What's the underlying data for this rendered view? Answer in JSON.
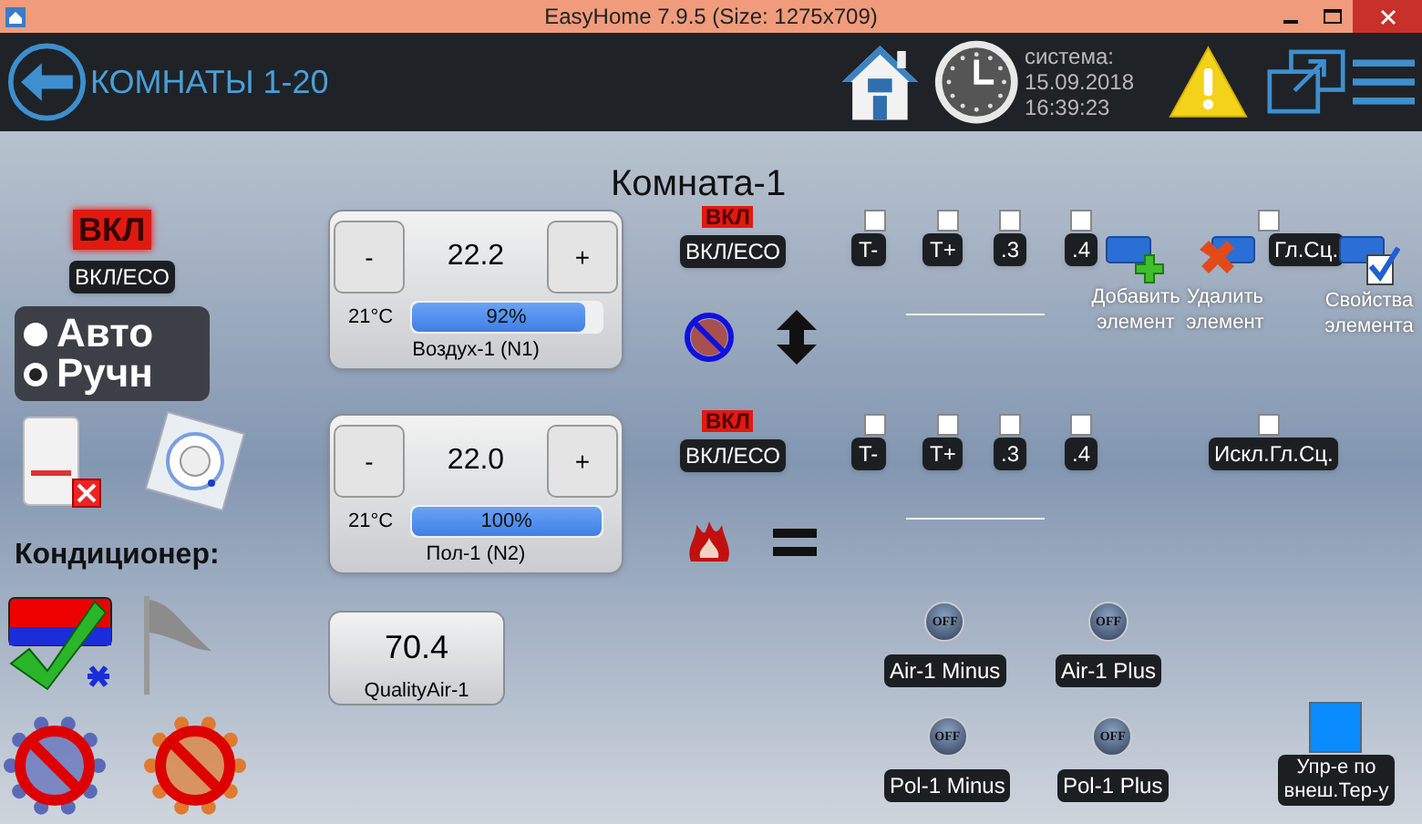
{
  "window": {
    "title": "EasyHome 7.9.5 (Size: 1275x709)"
  },
  "header": {
    "title": "КОМНАТЫ 1-20",
    "system_label": "система:",
    "date": "15.09.2018",
    "time": "16:39:23"
  },
  "room": {
    "title": "Комната-1"
  },
  "left_panel": {
    "power_badge": "ВКЛ",
    "power_button": "ВКЛ/ЕСО",
    "modes": [
      {
        "label": "Авто",
        "selected": false
      },
      {
        "label": "Ручн",
        "selected": true
      }
    ],
    "conditioner_label": "Кондиционер:"
  },
  "thermostats": [
    {
      "minus": "-",
      "value": "22.2",
      "plus": "+",
      "current": "21°C",
      "level": 0.92,
      "reading": "92%",
      "name": "Воздух-1 (N1)"
    },
    {
      "minus": "-",
      "value": "22.0",
      "plus": "+",
      "current": "21°C",
      "level": 1,
      "reading": "100%",
      "name": "Пол-1 (N2)"
    }
  ],
  "quality_air": {
    "value": "70.4",
    "name": "QualityAir-1"
  },
  "zones": [
    {
      "kind": "air",
      "power_badge": "ВКЛ",
      "power_button": "ВКЛ/ЕСО",
      "options": [
        {
          "label": "T-",
          "checked": false
        },
        {
          "label": "T+",
          "checked": false
        },
        {
          "label": ".3",
          "checked": false
        },
        {
          "label": ".4",
          "checked": false
        }
      ],
      "exclude": {
        "label": "Гл.Сц.",
        "checked": false
      }
    },
    {
      "kind": "floor",
      "power_badge": "ВКЛ",
      "power_button": "ВКЛ/ЕСО",
      "options": [
        {
          "label": "T-",
          "checked": false
        },
        {
          "label": "T+",
          "checked": false
        },
        {
          "label": ".3",
          "checked": false
        },
        {
          "label": ".4",
          "checked": false
        }
      ],
      "exclude": {
        "label": "Искл.Гл.Сц.",
        "checked": false
      }
    }
  ],
  "toolbar": [
    {
      "kind": "add",
      "label": "Добавить элемент"
    },
    {
      "kind": "delete",
      "label": "Удалить элемент"
    },
    {
      "kind": "properties",
      "label": "Свойства элемента"
    }
  ],
  "relays": [
    {
      "label": "Air-1 Minus",
      "status": "OFF"
    },
    {
      "label": "Air-1 Plus",
      "status": "OFF"
    },
    {
      "label": "Pol-1 Minus",
      "status": "OFF"
    },
    {
      "label": "Pol-1 Plus",
      "status": "OFF"
    }
  ],
  "external_control": {
    "label": "Упр-е по внеш.Тер-у"
  }
}
